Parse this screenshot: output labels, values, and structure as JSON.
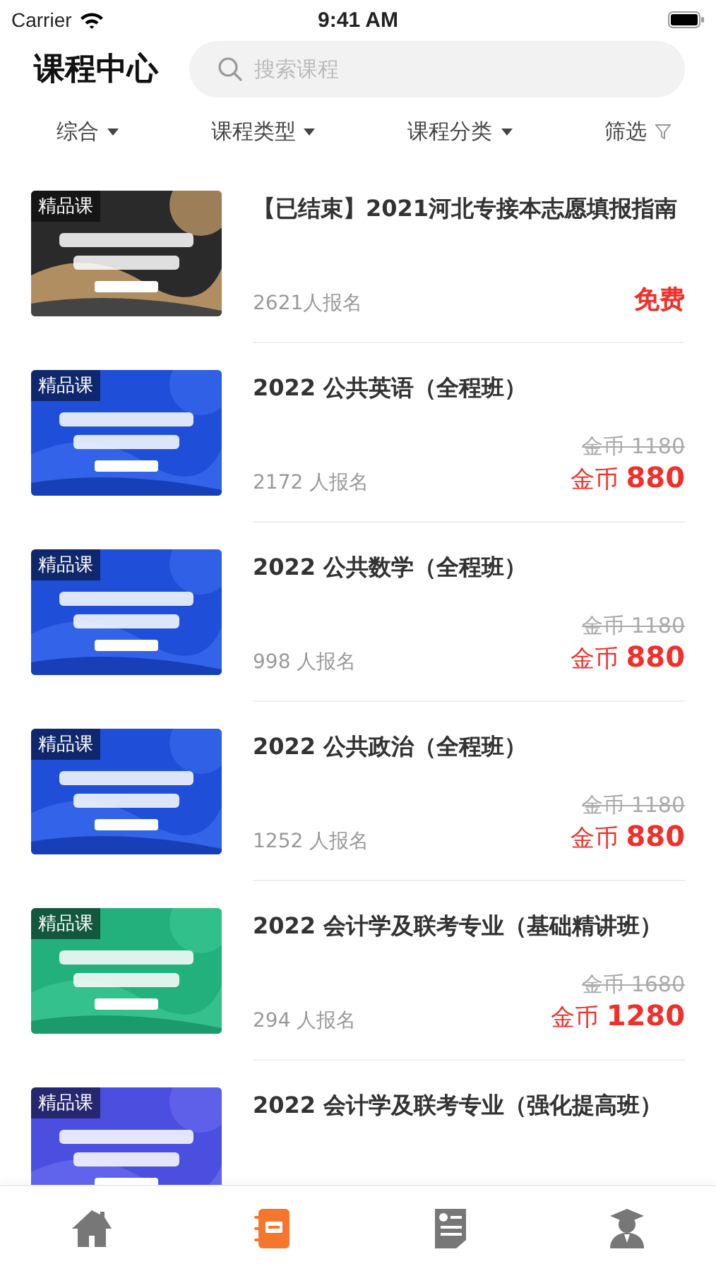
{
  "status_bar": {
    "carrier": "Carrier",
    "time": "9:41 AM"
  },
  "header": {
    "title": "课程中心",
    "search": {
      "placeholder": "搜索课程"
    }
  },
  "filters": [
    {
      "label": "综合",
      "kind": "dropdown"
    },
    {
      "label": "课程类型",
      "kind": "dropdown"
    },
    {
      "label": "课程分类",
      "kind": "dropdown"
    },
    {
      "label": "筛选",
      "kind": "filter"
    }
  ],
  "courses": [
    {
      "badge": "精品课",
      "title": "【已结束】2021河北专接本志愿填报指南",
      "enrolled": "2621人报名",
      "price": {
        "kind": "free",
        "text": "免费"
      }
    },
    {
      "badge": "精品课",
      "title": "2022 公共英语（全程班）",
      "enrolled": "2172 人报名",
      "old_price": "金币 1180",
      "price": {
        "kind": "coin",
        "text": "金币 **880**"
      }
    },
    {
      "badge": "精品课",
      "title": "2022 公共数学（全程班）",
      "enrolled": "998 人报名",
      "old_price": "金币 1180",
      "price": {
        "kind": "coin",
        "text": "金币 **880**"
      }
    },
    {
      "badge": "精品课",
      "title": "2022 公共政治（全程班）",
      "enrolled": "1252 人报名",
      "old_price": "金币 1180",
      "price": {
        "kind": "coin",
        "text": "金币 **880**"
      }
    },
    {
      "badge": "精品课",
      "title": "2022 会计学及联考专业（基础精讲班）",
      "enrolled": "294 人报名",
      "old_price": "金币 1680",
      "price": {
        "kind": "coin",
        "text": "金币 **1280**"
      }
    },
    {
      "badge": "精品课",
      "title": "2022 会计学及联考专业（强化提高班）"
    }
  ],
  "tab_bar": [
    {
      "kind": "home",
      "selected": false
    },
    {
      "kind": "courses",
      "selected": true
    },
    {
      "kind": "papers",
      "selected": false
    },
    {
      "kind": "profile",
      "selected": false
    }
  ]
}
